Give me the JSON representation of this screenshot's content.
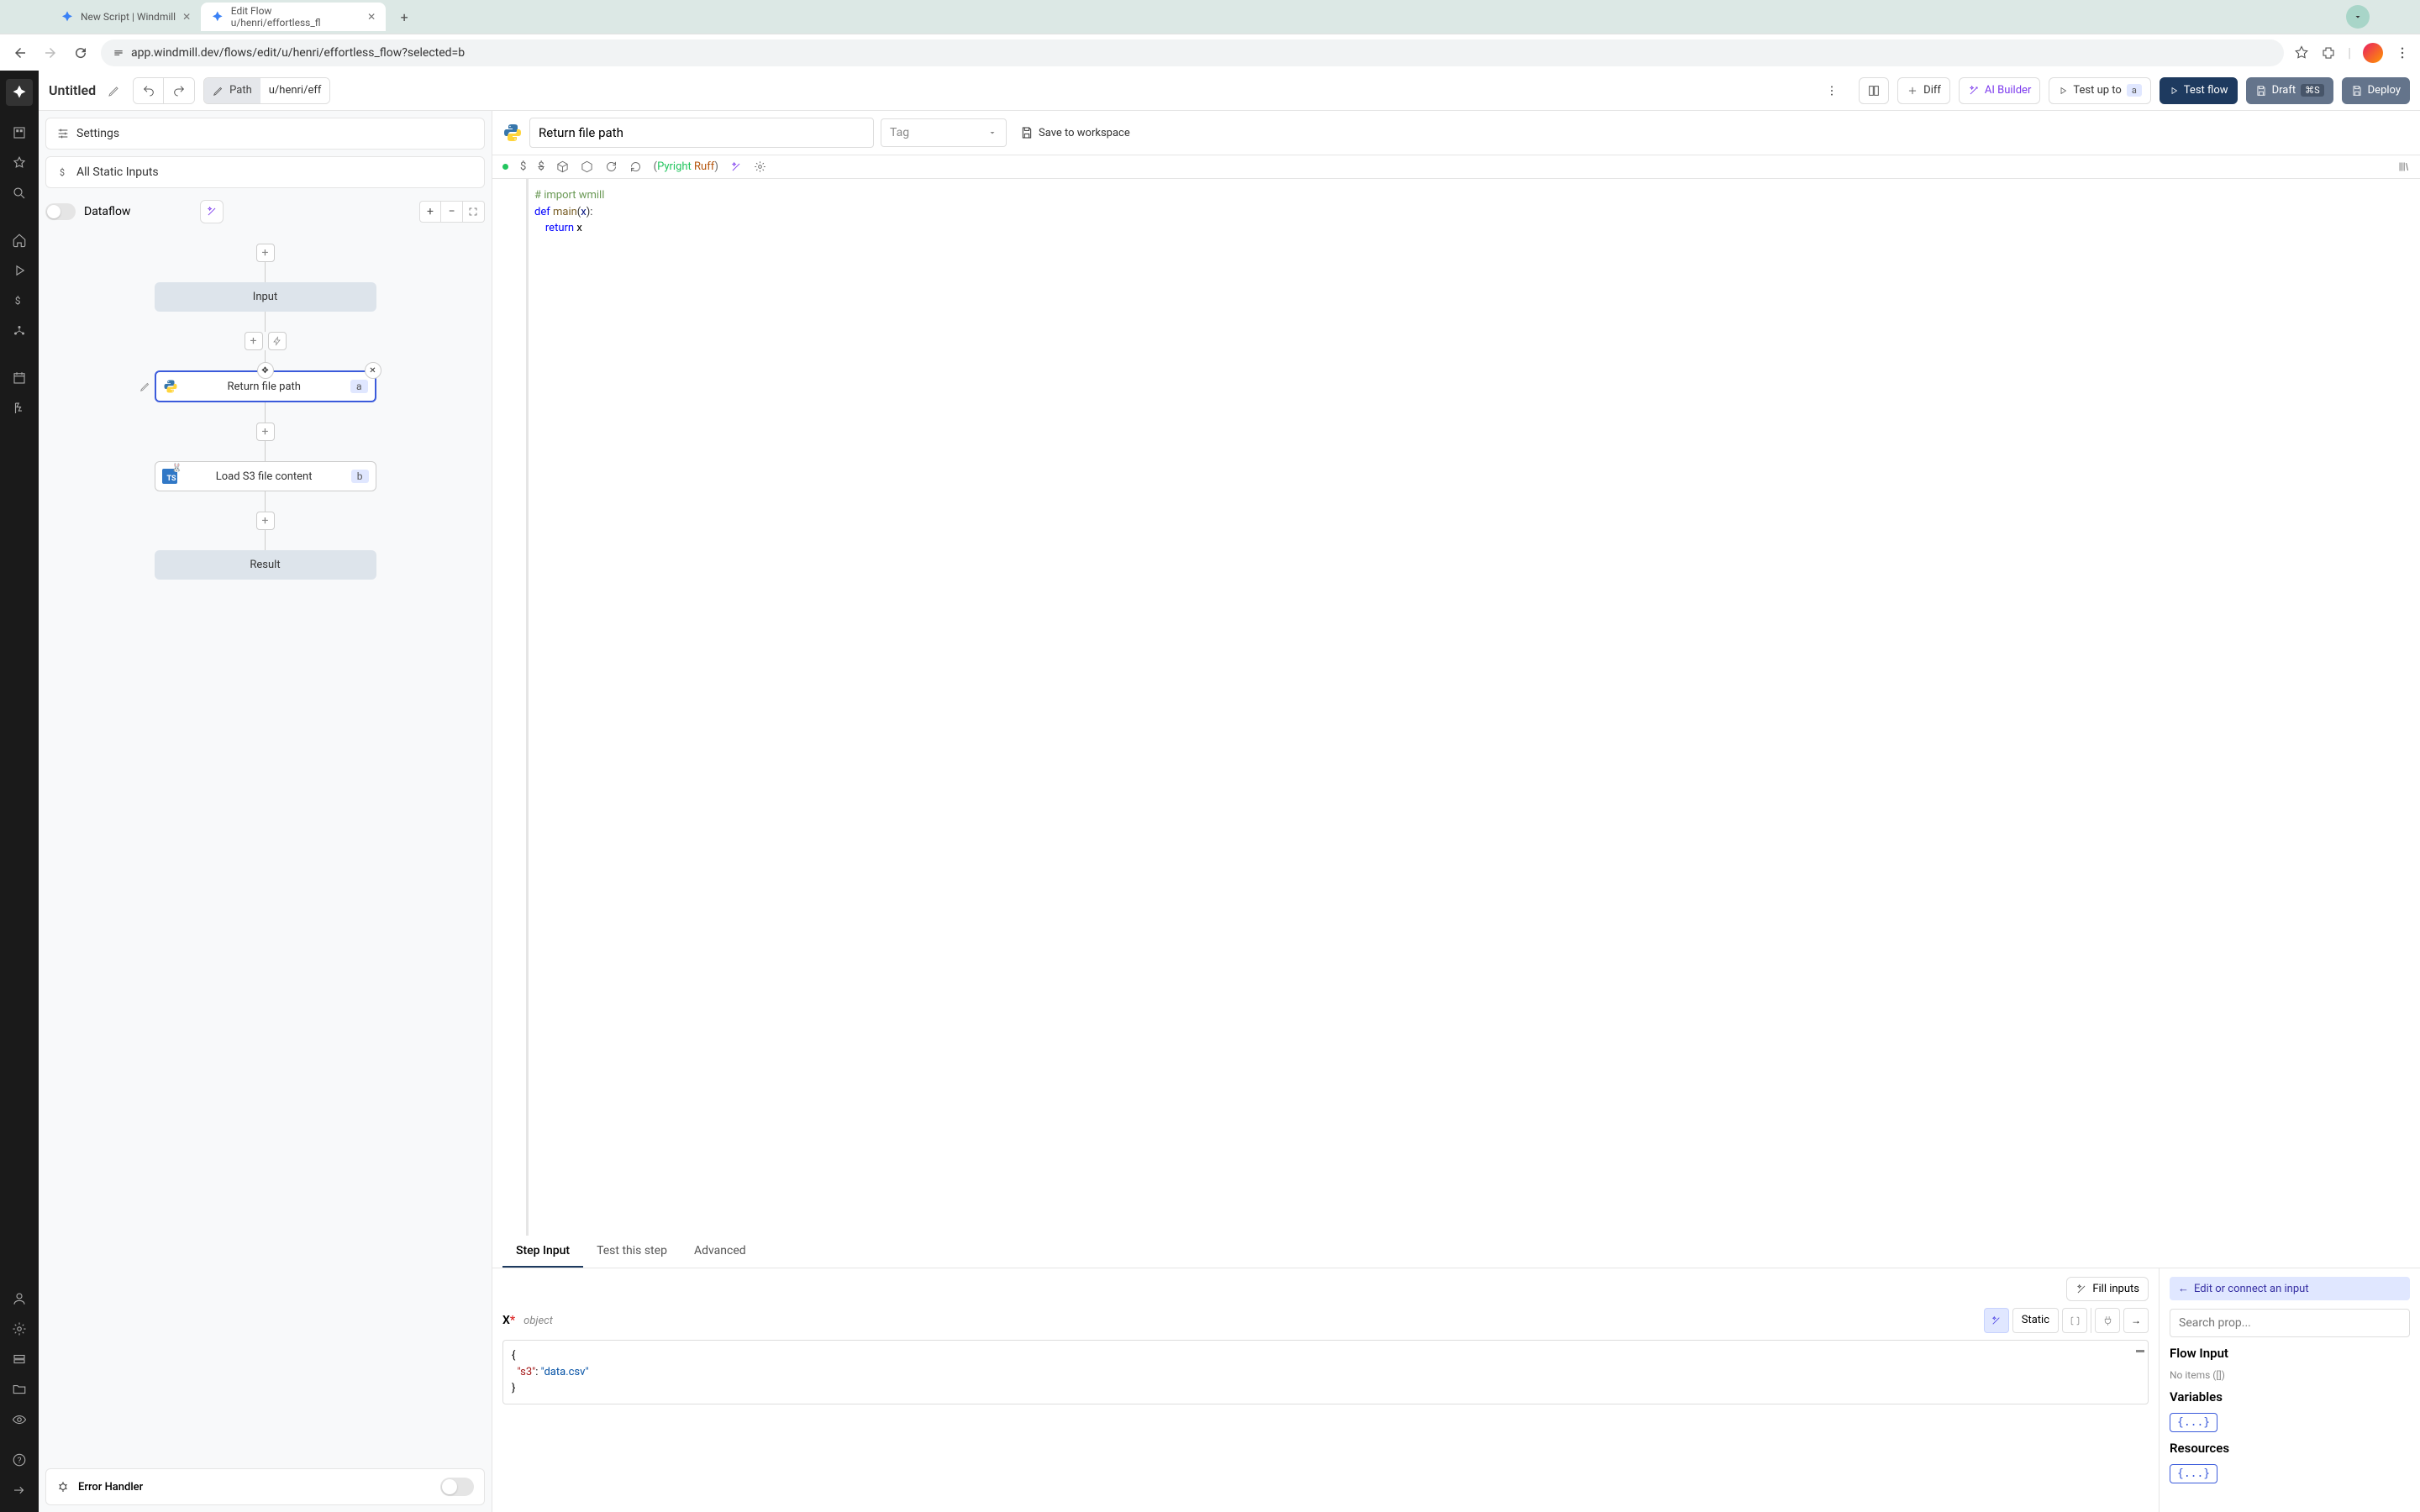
{
  "browser": {
    "tabs": [
      {
        "title": "New Script | Windmill",
        "active": false
      },
      {
        "title": "Edit Flow u/henri/effortless_fl",
        "active": true
      }
    ],
    "url": "app.windmill.dev/flows/edit/u/henri/effortless_flow?selected=b"
  },
  "topbar": {
    "title": "Untitled",
    "path_label": "Path",
    "path_value": "u/henri/eff",
    "diff": "Diff",
    "ai_builder": "AI Builder",
    "test_up_to": "Test up to",
    "test_up_to_chip": "a",
    "test_flow": "Test flow",
    "draft": "Draft",
    "draft_kbd": "⌘S",
    "deploy": "Deploy"
  },
  "left_panel": {
    "settings": "Settings",
    "all_static": "All Static Inputs",
    "dataflow": "Dataflow",
    "error_handler": "Error Handler"
  },
  "flow": {
    "input_node": "Input",
    "result_node": "Result",
    "steps": [
      {
        "letter": "a",
        "label": "Return file path",
        "lang": "python",
        "selected": true
      },
      {
        "letter": "b",
        "label": "Load S3 file content",
        "lang": "ts",
        "selected": false
      }
    ]
  },
  "editor": {
    "step_name": "Return file path",
    "tag_placeholder": "Tag",
    "save_to_workspace": "Save to workspace",
    "linter1": "Pyright",
    "linter2": "Ruff",
    "code_lines": [
      {
        "type": "comment",
        "text": "# import wmill"
      },
      {
        "type": "blank",
        "text": ""
      },
      {
        "type": "blank",
        "text": ""
      },
      {
        "type": "def",
        "kw": "def",
        "fn": "main",
        "param": "x",
        "tail": ":"
      },
      {
        "type": "return",
        "kw": "    return",
        "val": " x"
      }
    ]
  },
  "subtabs": {
    "step_input": "Step Input",
    "test_this": "Test this step",
    "advanced": "Advanced"
  },
  "step_input": {
    "fill_inputs": "Fill inputs",
    "param_name": "X",
    "param_type": "object",
    "static": "Static",
    "json_key": "\"s3\"",
    "json_val": "\"data.csv\""
  },
  "right_inspect": {
    "connect_banner": "Edit or connect an input",
    "search_placeholder": "Search prop...",
    "flow_input": "Flow Input",
    "no_items": "No items ([])",
    "variables": "Variables",
    "resources": "Resources",
    "brace": "{...}"
  }
}
